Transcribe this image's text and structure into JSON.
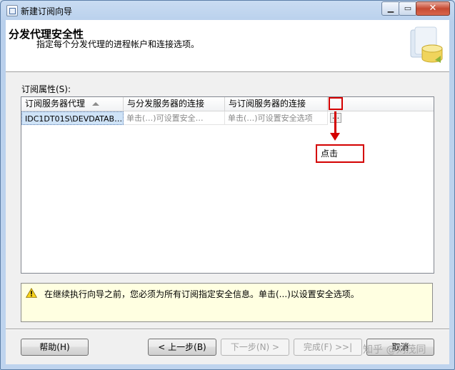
{
  "window": {
    "title": "新建订阅向导"
  },
  "header": {
    "title": "分发代理安全性",
    "subtitle": "指定每个分发代理的进程帐户和连接选项。"
  },
  "properties": {
    "label": "订阅属性(S):",
    "columns": [
      "订阅服务器代理",
      "与分发服务器的连接",
      "与订阅服务器的连接"
    ],
    "rows": [
      {
        "agent": "IDC1DT01S\\DEVDATAB…",
        "distributor_conn": "单击(…)可设置安全…",
        "subscriber_conn": "单击(…)可设置安全选项",
        "ellipsis": "…"
      }
    ]
  },
  "annotation": {
    "callout": "点击",
    "color": "#d40000"
  },
  "warning": {
    "text": "在继续执行向导之前，您必须为所有订阅指定安全信息。单击(...)以设置安全选项。"
  },
  "buttons": {
    "help": "帮助(H)",
    "back": "< 上一步(B)",
    "next": "下一步(N) >",
    "finish": "完成(F) >>|",
    "cancel": "取消"
  },
  "watermark": "知乎 @刘茂同"
}
